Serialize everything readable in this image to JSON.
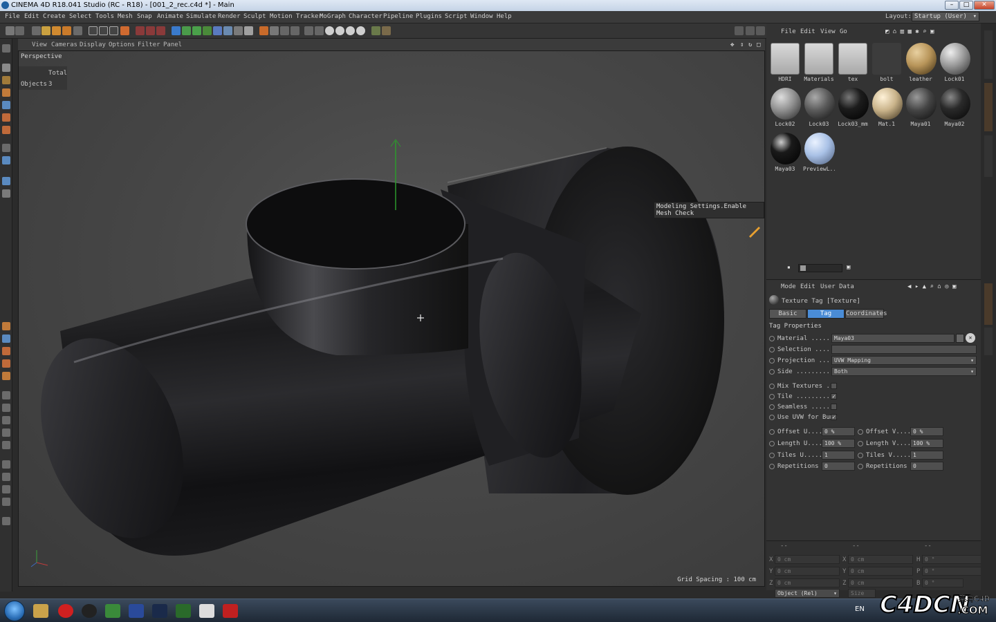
{
  "window": {
    "title": "CINEMA 4D R18.041 Studio (RC - R18) - [001_2_rec.c4d *] - Main"
  },
  "menubar": {
    "items": [
      "File",
      "Edit",
      "Create",
      "Select",
      "Tools",
      "Mesh",
      "Snap",
      "Animate",
      "Simulate",
      "Render",
      "Sculpt",
      "Motion Tracker",
      "MoGraph",
      "Character",
      "Pipeline",
      "Plugins",
      "Script",
      "Window",
      "Help"
    ],
    "layout_label": "Layout:",
    "layout_value": "Startup (User)"
  },
  "viewport": {
    "menu": [
      "View",
      "Cameras",
      "Display",
      "Options",
      "Filter",
      "Panel"
    ],
    "label": "Perspective",
    "hud_header": "Total",
    "hud_objects_label": "Objects",
    "hud_objects_value": "3",
    "grid_spacing": "Grid Spacing : 100 cm",
    "tooltip": "Modeling Settings.Enable Mesh Check"
  },
  "content_browser": {
    "menu": [
      "File",
      "Edit",
      "View",
      "Go"
    ],
    "items": [
      {
        "label": "HDRI",
        "kind": "folder"
      },
      {
        "label": "Materials",
        "kind": "folder"
      },
      {
        "label": "tex",
        "kind": "folder"
      },
      {
        "label": "bolt",
        "kind": "object"
      },
      {
        "label": "leather",
        "kind": "material",
        "color": "#b8955a"
      },
      {
        "label": "Lock01",
        "kind": "material",
        "color": "#9a9a9a"
      },
      {
        "label": "Lock02",
        "kind": "material",
        "color": "#8f8f8f"
      },
      {
        "label": "Lock03",
        "kind": "material",
        "color": "#5a5a5a"
      },
      {
        "label": "Lock03_mm",
        "kind": "material",
        "color": "#1c1c1c"
      },
      {
        "label": "Mat.1",
        "kind": "material",
        "color": "#c9b38a"
      },
      {
        "label": "Maya01",
        "kind": "material",
        "color": "#444444"
      },
      {
        "label": "Maya02",
        "kind": "material",
        "color": "#2a2a2a"
      },
      {
        "label": "Maya03",
        "kind": "material",
        "color": "#1a1a1a"
      },
      {
        "label": "PreviewL...",
        "kind": "material",
        "color": "#a9c1e6"
      }
    ]
  },
  "attributes": {
    "menu": [
      "Mode",
      "Edit",
      "User Data"
    ],
    "header": "Texture Tag [Texture]",
    "tabs": [
      "Basic",
      "Tag",
      "Coordinates"
    ],
    "active_tab": "Tag",
    "section": "Tag Properties",
    "material_label": "Material .......",
    "material_value": "Maya03",
    "selection_label": "Selection ......",
    "selection_value": "",
    "projection_label": "Projection .....",
    "projection_value": "UVW Mapping",
    "side_label": "Side ...........",
    "side_value": "Both",
    "mix_label": "Mix Textures ...",
    "tile_label": "Tile ...........",
    "seamless_label": "Seamless .......",
    "uvwbump_label": "Use UVW for Bump",
    "offset_u_label": "Offset U.....",
    "offset_u_value": "0 %",
    "offset_v_label": "Offset V.....",
    "offset_v_value": "0 %",
    "length_u_label": "Length U.....",
    "length_u_value": "100 %",
    "length_v_label": "Length V.....",
    "length_v_value": "100 %",
    "tiles_u_label": "Tiles U......",
    "tiles_u_value": "1",
    "tiles_v_label": "Tiles V......",
    "tiles_v_value": "1",
    "rep_u_label": "Repetitions U",
    "rep_u_value": "0",
    "rep_v_label": "Repetitions V",
    "rep_v_value": "0",
    "checks": {
      "mix": "",
      "tile": "✓",
      "seamless": "",
      "uvwbump": "✓"
    }
  },
  "coordinates": {
    "header": [
      "--",
      "--",
      "--"
    ],
    "rows": [
      [
        "X",
        "0 cm",
        "X",
        "0 cm",
        "H",
        "0 °"
      ],
      [
        "Y",
        "0 cm",
        "Y",
        "0 cm",
        "P",
        "0 °"
      ],
      [
        "Z",
        "0 cm",
        "Z",
        "0 cm",
        "B",
        "0 °"
      ]
    ],
    "mode": "Object (Rel)",
    "size": "Size"
  },
  "taskbar": {
    "lang": "EN"
  },
  "watermark": {
    "text": "C4DCN.COM",
    "subtext": "菜鸟C4D"
  },
  "colors": {
    "accent": "#4a8cd6",
    "viewport_bg": "#474747",
    "panel_bg": "#333333"
  }
}
